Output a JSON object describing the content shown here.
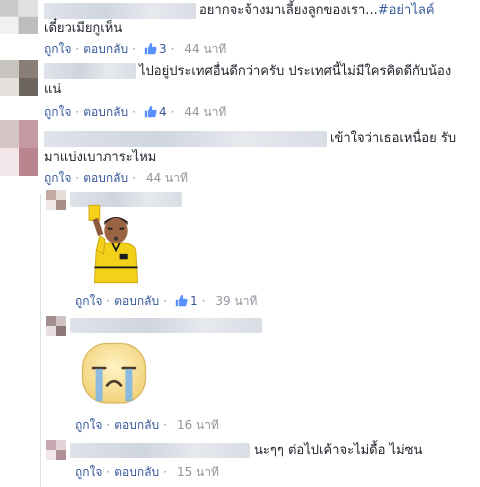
{
  "comments": [
    {
      "text": "อยากจะจ้างมาเลี้ยงลูกของเรา...",
      "tag": "#อย่าไลค์",
      "text_line2": "เดี๋ยวเมียกูเห็น",
      "like": "ถูกใจ",
      "reply": "ตอบกลับ",
      "likes": "3",
      "time": "44 นาที"
    },
    {
      "text": "ไปอยู่ประเทศอื่นดีกว่าครับ ประเทศนี้ไม่มีใครคิดดีกับน้อง",
      "text_line2": "แน่",
      "like": "ถูกใจ",
      "reply": "ตอบกลับ",
      "likes": "4",
      "time": "44 นาที"
    },
    {
      "text": "เข้าใจว่าเธอเหนื่อย รับ",
      "text_line2": "มาแบ่งเบาภาระไหม",
      "like": "ถูกใจ",
      "reply": "ตอบกลับ",
      "time": "44 นาที"
    }
  ],
  "replies": [
    {
      "sticker": "referee-sticker",
      "like": "ถูกใจ",
      "reply": "ตอบกลับ",
      "likes": "1",
      "time": "39 นาที"
    },
    {
      "sticker": "crying-face-sticker",
      "like": "ถูกใจ",
      "reply": "ตอบกลับ",
      "time": "16 นาที"
    },
    {
      "text": "นะๆๆ ต่อไปเค้าจะไม่ดื้อ ไม่ซน",
      "like": "ถูกใจ",
      "reply": "ตอบกลับ",
      "time": "15 นาที"
    }
  ],
  "colors": {
    "link": "#365899",
    "meta": "#90949c",
    "text": "#1d2129",
    "referee_shirt": "#f3d11b",
    "card": "#f7d117"
  }
}
